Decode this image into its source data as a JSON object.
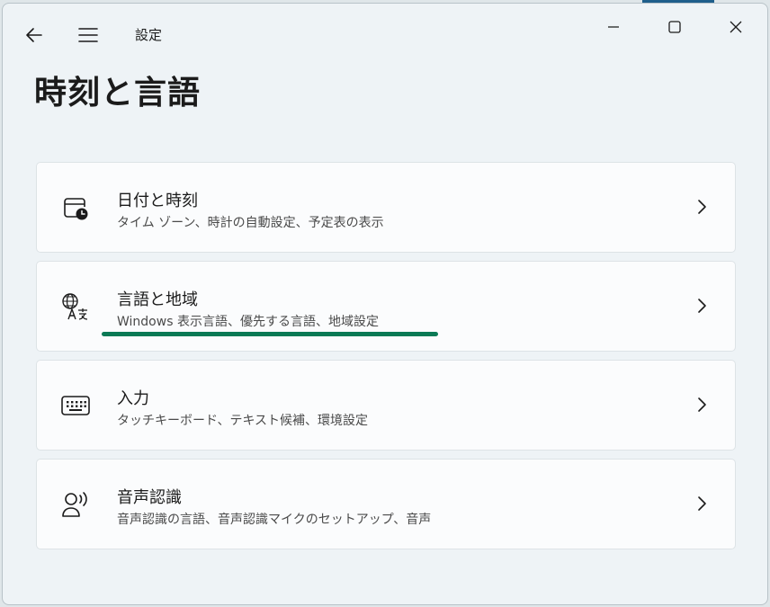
{
  "app": {
    "title": "設定"
  },
  "page": {
    "title": "時刻と言語"
  },
  "items": [
    {
      "title": "日付と時刻",
      "subtitle": "タイム ゾーン、時計の自動設定、予定表の表示",
      "icon": "calendar-clock-icon"
    },
    {
      "title": "言語と地域",
      "subtitle": "Windows 表示言語、優先する言語、地域設定",
      "icon": "language-region-icon"
    },
    {
      "title": "入力",
      "subtitle": "タッチキーボード、テキスト候補、環境設定",
      "icon": "keyboard-icon"
    },
    {
      "title": "音声認識",
      "subtitle": "音声認識の言語、音声認識マイクのセットアップ、音声",
      "icon": "speech-icon"
    }
  ],
  "colors": {
    "highlight_underline": "#0b7a55",
    "window_bg": "#eef3f6",
    "card_bg": "#fbfcfd"
  }
}
